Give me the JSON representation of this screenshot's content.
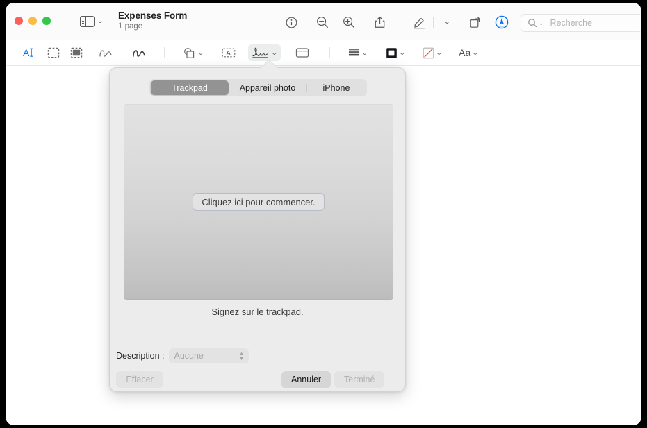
{
  "window": {
    "title": "Expenses Form",
    "subtitle": "1 page"
  },
  "titlebar": {
    "traffic_lights": [
      "close",
      "minimize",
      "zoom"
    ],
    "sidebar_toggle": "sidebar-icon",
    "buttons": [
      {
        "name": "info-icon",
        "label": "Infos"
      },
      {
        "name": "zoom-out-icon",
        "label": "Zoom arrière"
      },
      {
        "name": "zoom-in-icon",
        "label": "Zoom avant"
      },
      {
        "name": "share-icon",
        "label": "Partager"
      },
      {
        "name": "markup-pen-icon",
        "label": "Annoter"
      },
      {
        "name": "chevron-down-icon",
        "label": "Plus"
      },
      {
        "name": "rotate-icon",
        "label": "Faire pivoter"
      },
      {
        "name": "annotate-badge-icon",
        "label": "Annoter"
      }
    ]
  },
  "search": {
    "placeholder": "Recherche",
    "icon": "search-icon"
  },
  "markup_toolbar": {
    "tools": [
      {
        "name": "text-selection-tool",
        "icon": "text-cursor-icon",
        "active": false
      },
      {
        "name": "rectangular-selection-tool",
        "icon": "dashed-rectangle-icon",
        "active": false
      },
      {
        "name": "instant-alpha-tool",
        "icon": "filled-selection-icon",
        "active": false
      },
      {
        "name": "sketch-tool",
        "icon": "sketch-squiggle-icon",
        "active": false
      },
      {
        "name": "draw-tool",
        "icon": "draw-squiggle-icon",
        "active": false
      },
      {
        "name": "shapes-tool",
        "icon": "shapes-icon",
        "active": false
      },
      {
        "name": "text-tool",
        "icon": "text-box-icon",
        "active": false
      },
      {
        "name": "signature-tool",
        "icon": "signature-icon",
        "active": true
      },
      {
        "name": "note-tool",
        "icon": "note-icon",
        "active": false
      },
      {
        "name": "shape-style-tool",
        "icon": "line-weight-icon",
        "active": false
      },
      {
        "name": "border-color-tool",
        "icon": "border-color-icon",
        "active": false
      },
      {
        "name": "fill-color-tool",
        "icon": "fill-color-icon",
        "active": false
      },
      {
        "name": "text-style-tool",
        "icon": "Aa",
        "active": false
      }
    ]
  },
  "signature_popover": {
    "tabs": [
      {
        "label": "Trackpad",
        "selected": true
      },
      {
        "label": "Appareil photo",
        "selected": false
      },
      {
        "label": "iPhone",
        "selected": false
      }
    ],
    "canvas": {
      "start_button_label": "Cliquez ici pour commencer."
    },
    "instruction": "Signez sur le trackpad.",
    "description": {
      "label": "Description :",
      "value": "Aucune",
      "enabled": false
    },
    "buttons": {
      "clear": {
        "label": "Effacer",
        "enabled": false
      },
      "cancel": {
        "label": "Annuler",
        "enabled": true
      },
      "done": {
        "label": "Terminé",
        "enabled": false
      }
    }
  },
  "colors": {
    "accent_blue": "#0a75f0",
    "tab_selected_bg": "#939394",
    "popover_bg": "#ececec",
    "titlebar_bg": "#fbfbfb"
  }
}
